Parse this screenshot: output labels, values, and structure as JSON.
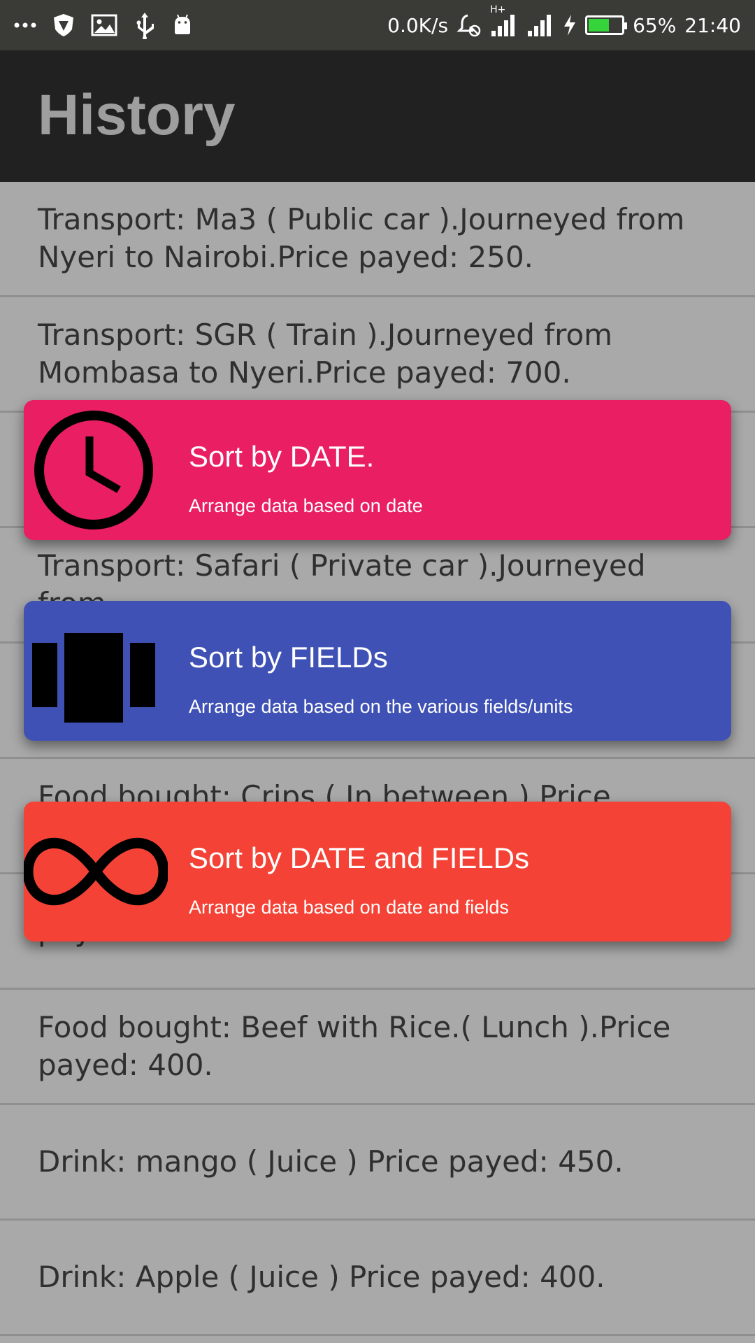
{
  "status_bar": {
    "left_icons": [
      "more-dots-icon",
      "shield-icon",
      "image-icon",
      "usb-icon",
      "android-icon"
    ],
    "network_speed": "0.0K/s",
    "network_type": "H+",
    "battery_percent": "65%",
    "battery_level": 0.65,
    "time": "21:40"
  },
  "app_bar": {
    "title": "History"
  },
  "history": {
    "items": [
      "Transport: Ma3 ( Public car ).Journeyed from Nyeri to Nairobi.Price payed: 250.",
      "Transport: SGR ( Train ).Journeyed from Mombasa to Nyeri.Price payed: 700.",
      "",
      "Transport: Safari ( Private car ).Journeyed from",
      "",
      "Food bought: Crips ( In between ) Price payed:",
      "payed: 400.",
      "Food bought: Beef with Rice.( Lunch ).Price payed: 400.",
      "Drink: mango ( Juice ) Price payed: 450.",
      "Drink: Apple ( Juice ) Price payed: 400."
    ]
  },
  "sort_options": [
    {
      "title": "Sort by DATE.",
      "subtitle": "Arrange data based on date",
      "icon": "clock-icon",
      "color": "#e91e63"
    },
    {
      "title": "Sort by FIELDs",
      "subtitle": "Arrange data based on the various fields/units",
      "icon": "carousel-icon",
      "color": "#3f51b5"
    },
    {
      "title": "Sort by DATE and FIELDs",
      "subtitle": "Arrange data based on date and fields",
      "icon": "infinity-icon",
      "color": "#f44336"
    }
  ],
  "colors": {
    "status_bar_bg": "#3a3a37",
    "app_bar_bg": "#212121",
    "list_bg": "#a9a9a9"
  }
}
